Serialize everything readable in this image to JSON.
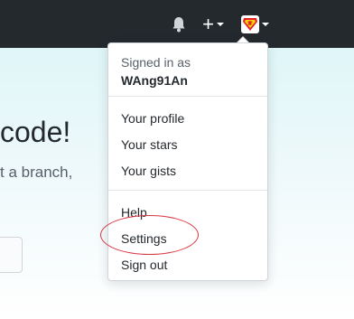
{
  "hero": {
    "heading": "code!",
    "text": "t a branch,"
  },
  "nav": {
    "icons": [
      "bell-icon",
      "plus-icon",
      "caret-down-icon",
      "avatar-icon"
    ]
  },
  "menu": {
    "signed_in_label": "Signed in as",
    "username": "WAng91An",
    "items_primary": [
      "Your profile",
      "Your stars",
      "Your gists"
    ],
    "items_secondary": [
      "Help",
      "Settings",
      "Sign out"
    ]
  },
  "colors": {
    "topbar": "#24292e",
    "annotation": "#d9353f"
  }
}
